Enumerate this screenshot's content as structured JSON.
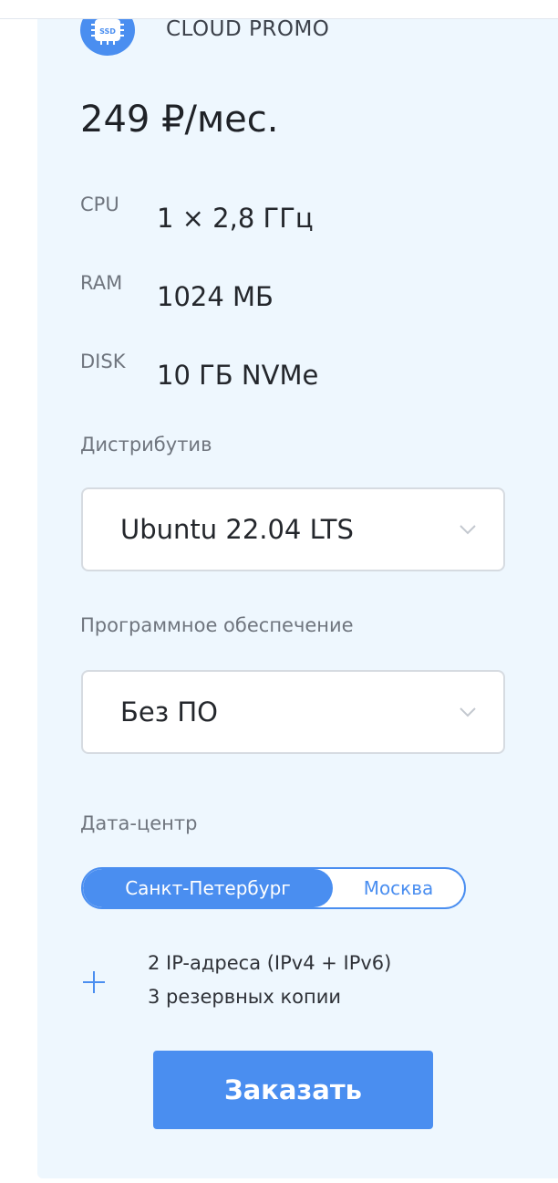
{
  "plan": {
    "icon_text": "SSD",
    "name": "CLOUD PROMO",
    "price": "249 ₽/мес."
  },
  "specs": [
    {
      "key": "CPU",
      "value": "1 × 2,8 ГГц"
    },
    {
      "key": "RAM",
      "value": "1024 МБ"
    },
    {
      "key": "DISK",
      "value": "10 ГБ NVMe"
    }
  ],
  "distro": {
    "label": "Дистрибутив",
    "value": "Ubuntu 22.04 LTS"
  },
  "software": {
    "label": "Программное обеспечение",
    "value": "Без ПО"
  },
  "datacenter": {
    "label": "Дата-центр",
    "options": [
      "Санкт-Петербург",
      "Москва"
    ],
    "selected": "Санкт-Петербург"
  },
  "extras": [
    "2 IP-адреса (IPv4 + IPv6)",
    "3 резервных копии"
  ],
  "order_button": "Заказать",
  "colors": {
    "accent": "#4a8ef0",
    "card_background": "#eef7fe"
  },
  "icons": [
    "ssd-chip-icon",
    "chevron-down-icon",
    "plus-icon"
  ]
}
